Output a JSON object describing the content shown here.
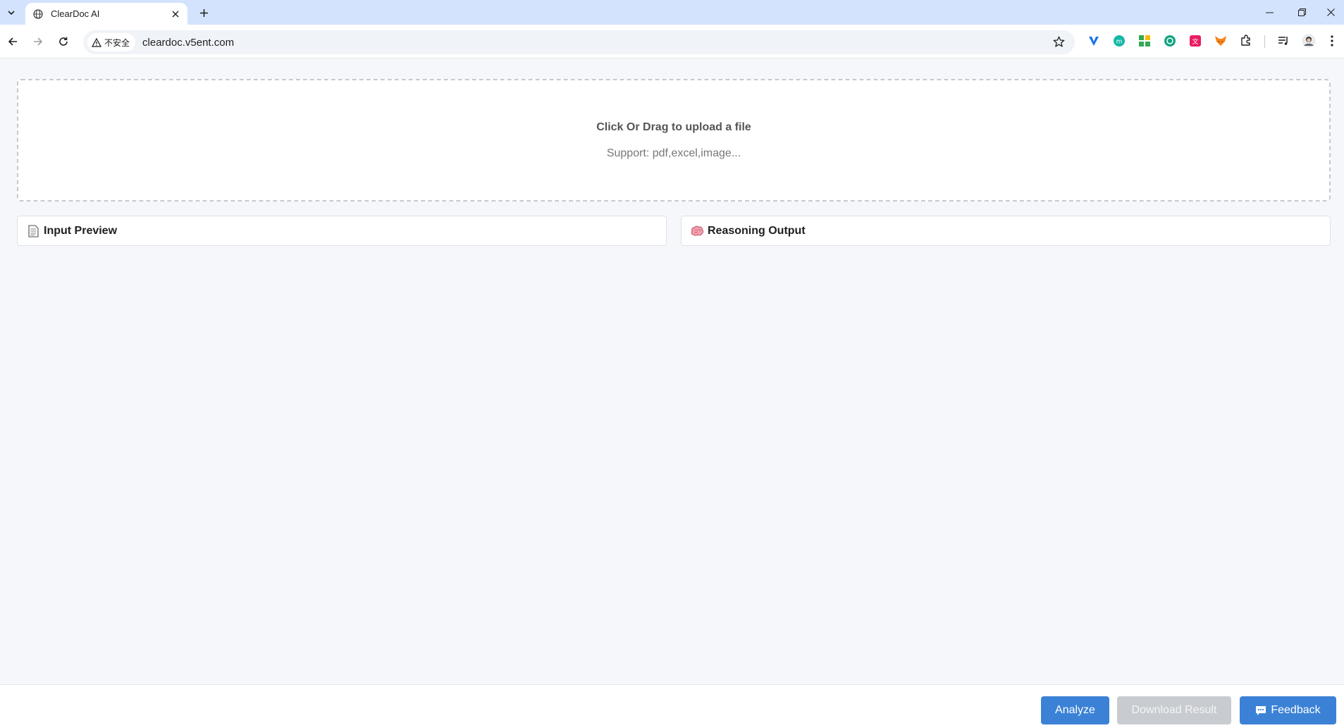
{
  "browser": {
    "tab_title": "ClearDoc AI",
    "security_label": "不安全",
    "url": "cleardoc.v5ent.com"
  },
  "upload": {
    "title": "Click Or Drag to upload a file",
    "subtitle": "Support: pdf,excel,image..."
  },
  "panels": {
    "input_preview": {
      "label": "Input Preview",
      "icon": "page-icon"
    },
    "reasoning_output": {
      "label": "Reasoning Output",
      "icon": "brain-icon"
    }
  },
  "footer": {
    "analyze_label": "Analyze",
    "download_label": "Download Result",
    "feedback_label": "Feedback"
  },
  "colors": {
    "primary": "#3b82d6",
    "disabled": "#c8ccd1",
    "page_bg": "#f5f7fa",
    "tabstrip_bg": "#d3e3fd"
  }
}
